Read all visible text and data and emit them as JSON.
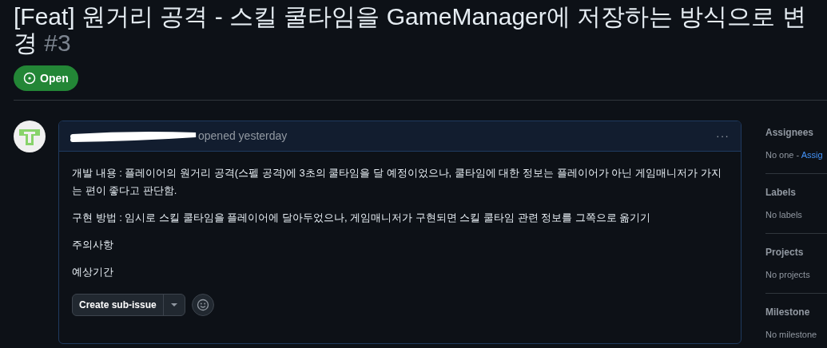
{
  "issue": {
    "title": "[Feat] 원거리 공격 - 스킬 쿨타임을 GameManager에 저장하는 방식으로 변경",
    "number": "#3",
    "state": {
      "kind": "open",
      "label": "Open"
    }
  },
  "comment": {
    "author_redacted": true,
    "action": "opened yesterday",
    "menu": "···",
    "body": [
      "개발 내용 : 플레이어의 원거리 공격(스펠 공격)에 3초의 쿨타임을 달 예정이었으나, 쿨타임에 대한 정보는 플레이어가 아닌 게임매니저가 가지는 편이 좋다고 판단함.",
      "구현 방법 : 임시로 스킬 쿨타임을 플레이어에 달아두었으나, 게임매니저가 구현되면 스킬 쿨타임 관련 정보를 그쪽으로 옮기기",
      "주의사항",
      "예상기간"
    ],
    "create_button": "Create sub-issue"
  },
  "sidebar": [
    {
      "heading": "Assignees",
      "value": "No one - ",
      "link": "Assig"
    },
    {
      "heading": "Labels",
      "value": "No labels"
    },
    {
      "heading": "Projects",
      "value": "No projects"
    },
    {
      "heading": "Milestone",
      "value": "No milestone"
    }
  ]
}
